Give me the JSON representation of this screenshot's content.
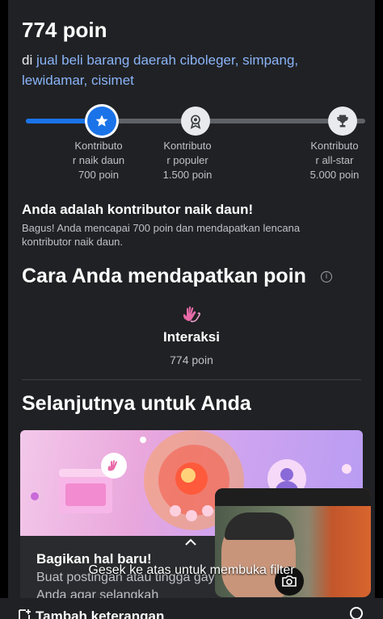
{
  "header": {
    "points_label": "774 poin",
    "location_prefix": "di ",
    "location_link": "jual beli barang daerah cibolеger, simpang, lewidamar, cisimet"
  },
  "progress": {
    "fill_fraction": 0.25,
    "levels": [
      {
        "line1": "Kontributo",
        "line2": "r naik daun",
        "line3": "700 poin",
        "icon": "star-icon",
        "state": "active"
      },
      {
        "line1": "Kontributo",
        "line2": "r populer",
        "line3": "1.500 poin",
        "icon": "medal-icon",
        "state": "locked"
      },
      {
        "line1": "Kontributo",
        "line2": "r all-star",
        "line3": "5.000 poin",
        "icon": "trophy-icon",
        "state": "locked"
      }
    ]
  },
  "badge": {
    "title": "Anda adalah kontributor naik daun!",
    "description": "Bagus! Anda mencapai 700 poin dan mendapatkan lencana kontributor naik daun."
  },
  "how_to_earn": {
    "title": "Cara Anda mendapatkan poin",
    "info_glyph": "i",
    "item_label": "Interaksi",
    "item_points": "774 poin"
  },
  "next": {
    "title": "Selanjutnya untuk Anda",
    "card_title": "Bagikan hal baru!",
    "card_description": "Buat postingan atau tingga gaya Anda agar selangkah"
  },
  "overlay": {
    "swipe_hint": "Gesek ke atas untuk membuka filter",
    "bottom_label": "Tambah keterangan"
  },
  "colors": {
    "accent": "#1a73e8",
    "link": "#8ab4f8",
    "background": "#202124"
  }
}
